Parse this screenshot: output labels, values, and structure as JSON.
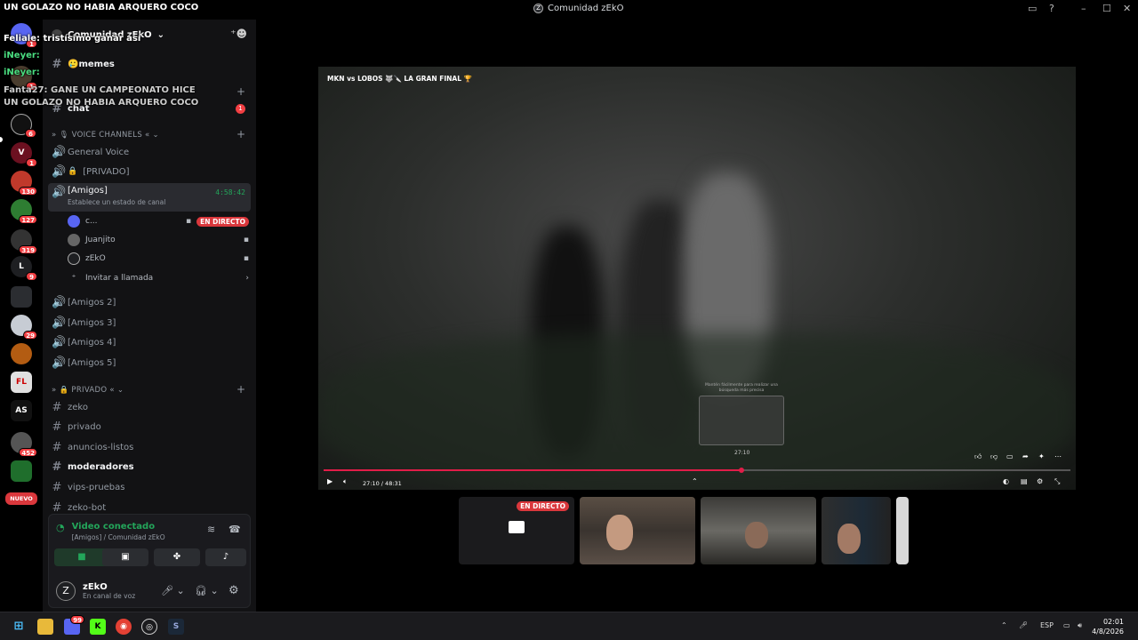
{
  "window": {
    "title": "Comunidad zEkO",
    "logo_letter": "Z"
  },
  "chat_overlay": [
    {
      "name": "",
      "text": "UN GOLAZO NO HABIA ARQUERO COCO"
    },
    {
      "name": "",
      "text": "Feliale: tristísimo ganar así"
    },
    {
      "name": "iNeyer:",
      "text": ""
    },
    {
      "name": "iNeyer:",
      "text": ""
    },
    {
      "name": "",
      "text": "Fanta27: GANE UN CAMPEONATO HICE"
    },
    {
      "name": "",
      "text": "UN GOLAZO NO HABIA ARQUERO COCO"
    }
  ],
  "servers": [
    {
      "label": "",
      "badge": "1"
    },
    {
      "label": "",
      "badge": "1"
    },
    {
      "label": "",
      "badge": "6"
    },
    {
      "label": "V",
      "badge": "1"
    },
    {
      "label": "",
      "badge": "130"
    },
    {
      "label": "",
      "badge": "127"
    },
    {
      "label": "",
      "badge": "319"
    },
    {
      "label": "L",
      "badge": "9"
    },
    {
      "label": "",
      "badge": ""
    },
    {
      "label": "",
      "badge": "29"
    },
    {
      "label": "",
      "badge": ""
    },
    {
      "label": "FL",
      "badge": ""
    },
    {
      "label": "AS",
      "badge": ""
    },
    {
      "label": "",
      "badge": "452"
    },
    {
      "label": "",
      "badge": ""
    },
    {
      "label": "NUEVO",
      "badge": ""
    }
  ],
  "guild": {
    "name": "Comunidad zEkO"
  },
  "channels_top": [
    {
      "name": "🥲memes",
      "bright": true
    },
    {
      "name": "chat",
      "bright": true,
      "unread": "1"
    }
  ],
  "categories": {
    "voice": "VOICE CHANNELS",
    "private": "PRIVADO"
  },
  "voice_channels": [
    {
      "name": "General Voice"
    },
    {
      "name": "[PRIVADO]"
    },
    {
      "name": "[Amigos]",
      "timer": "4:58:42",
      "status": "Establece un estado de canal"
    }
  ],
  "voice_users": [
    {
      "name": "c...",
      "live": "EN DIRECTO"
    },
    {
      "name": "Juanjito"
    },
    {
      "name": "zEkO"
    }
  ],
  "invite_label": "Invitar a llamada",
  "voice_channels_more": [
    {
      "name": "[Amigos 2]"
    },
    {
      "name": "[Amigos 3]"
    },
    {
      "name": "[Amigos 4]"
    },
    {
      "name": "[Amigos 5]"
    }
  ],
  "private_channels": [
    {
      "name": "zeko",
      "bright": false
    },
    {
      "name": "privado",
      "bright": false
    },
    {
      "name": "anuncios-listos",
      "bright": false
    },
    {
      "name": "moderadores",
      "bright": true
    },
    {
      "name": "vips-pruebas",
      "bright": false
    },
    {
      "name": "zeko-bot",
      "bright": false
    }
  ],
  "voice_panel": {
    "status": "Video conectado",
    "location": "[Amigos] / Comunidad zEkO"
  },
  "user": {
    "name": "zEkO",
    "status": "En canal de voz",
    "avatar_letter": "Z"
  },
  "stream": {
    "video_title": "MKN vs LOBOS 🐺🔪 LA GRAN FINAL 🏆",
    "time": "27:10 / 48:31",
    "preview_time": "27:10",
    "progress": 0.56,
    "preview_hint": "Mantén fácilmente para realizar una búsqueda más precisa"
  },
  "thumbs": {
    "live": "EN DIRECTO"
  },
  "taskbar": {
    "lang": "ESP",
    "time": "02:01",
    "date": "4/8/2026",
    "discord_badge": "99"
  },
  "colors": {
    "live": "#da373c",
    "connected": "#23a55a",
    "progress": "#e11d48"
  }
}
